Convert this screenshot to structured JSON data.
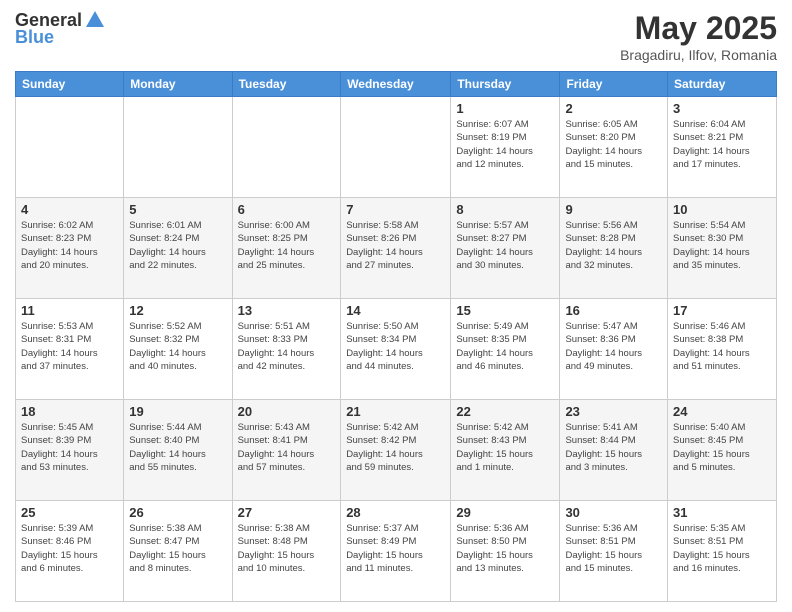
{
  "header": {
    "logo_general": "General",
    "logo_blue": "Blue",
    "title": "May 2025",
    "location": "Bragadiru, Ilfov, Romania"
  },
  "weekdays": [
    "Sunday",
    "Monday",
    "Tuesday",
    "Wednesday",
    "Thursday",
    "Friday",
    "Saturday"
  ],
  "weeks": [
    [
      {
        "day": "",
        "info": ""
      },
      {
        "day": "",
        "info": ""
      },
      {
        "day": "",
        "info": ""
      },
      {
        "day": "",
        "info": ""
      },
      {
        "day": "1",
        "info": "Sunrise: 6:07 AM\nSunset: 8:19 PM\nDaylight: 14 hours\nand 12 minutes."
      },
      {
        "day": "2",
        "info": "Sunrise: 6:05 AM\nSunset: 8:20 PM\nDaylight: 14 hours\nand 15 minutes."
      },
      {
        "day": "3",
        "info": "Sunrise: 6:04 AM\nSunset: 8:21 PM\nDaylight: 14 hours\nand 17 minutes."
      }
    ],
    [
      {
        "day": "4",
        "info": "Sunrise: 6:02 AM\nSunset: 8:23 PM\nDaylight: 14 hours\nand 20 minutes."
      },
      {
        "day": "5",
        "info": "Sunrise: 6:01 AM\nSunset: 8:24 PM\nDaylight: 14 hours\nand 22 minutes."
      },
      {
        "day": "6",
        "info": "Sunrise: 6:00 AM\nSunset: 8:25 PM\nDaylight: 14 hours\nand 25 minutes."
      },
      {
        "day": "7",
        "info": "Sunrise: 5:58 AM\nSunset: 8:26 PM\nDaylight: 14 hours\nand 27 minutes."
      },
      {
        "day": "8",
        "info": "Sunrise: 5:57 AM\nSunset: 8:27 PM\nDaylight: 14 hours\nand 30 minutes."
      },
      {
        "day": "9",
        "info": "Sunrise: 5:56 AM\nSunset: 8:28 PM\nDaylight: 14 hours\nand 32 minutes."
      },
      {
        "day": "10",
        "info": "Sunrise: 5:54 AM\nSunset: 8:30 PM\nDaylight: 14 hours\nand 35 minutes."
      }
    ],
    [
      {
        "day": "11",
        "info": "Sunrise: 5:53 AM\nSunset: 8:31 PM\nDaylight: 14 hours\nand 37 minutes."
      },
      {
        "day": "12",
        "info": "Sunrise: 5:52 AM\nSunset: 8:32 PM\nDaylight: 14 hours\nand 40 minutes."
      },
      {
        "day": "13",
        "info": "Sunrise: 5:51 AM\nSunset: 8:33 PM\nDaylight: 14 hours\nand 42 minutes."
      },
      {
        "day": "14",
        "info": "Sunrise: 5:50 AM\nSunset: 8:34 PM\nDaylight: 14 hours\nand 44 minutes."
      },
      {
        "day": "15",
        "info": "Sunrise: 5:49 AM\nSunset: 8:35 PM\nDaylight: 14 hours\nand 46 minutes."
      },
      {
        "day": "16",
        "info": "Sunrise: 5:47 AM\nSunset: 8:36 PM\nDaylight: 14 hours\nand 49 minutes."
      },
      {
        "day": "17",
        "info": "Sunrise: 5:46 AM\nSunset: 8:38 PM\nDaylight: 14 hours\nand 51 minutes."
      }
    ],
    [
      {
        "day": "18",
        "info": "Sunrise: 5:45 AM\nSunset: 8:39 PM\nDaylight: 14 hours\nand 53 minutes."
      },
      {
        "day": "19",
        "info": "Sunrise: 5:44 AM\nSunset: 8:40 PM\nDaylight: 14 hours\nand 55 minutes."
      },
      {
        "day": "20",
        "info": "Sunrise: 5:43 AM\nSunset: 8:41 PM\nDaylight: 14 hours\nand 57 minutes."
      },
      {
        "day": "21",
        "info": "Sunrise: 5:42 AM\nSunset: 8:42 PM\nDaylight: 14 hours\nand 59 minutes."
      },
      {
        "day": "22",
        "info": "Sunrise: 5:42 AM\nSunset: 8:43 PM\nDaylight: 15 hours\nand 1 minute."
      },
      {
        "day": "23",
        "info": "Sunrise: 5:41 AM\nSunset: 8:44 PM\nDaylight: 15 hours\nand 3 minutes."
      },
      {
        "day": "24",
        "info": "Sunrise: 5:40 AM\nSunset: 8:45 PM\nDaylight: 15 hours\nand 5 minutes."
      }
    ],
    [
      {
        "day": "25",
        "info": "Sunrise: 5:39 AM\nSunset: 8:46 PM\nDaylight: 15 hours\nand 6 minutes."
      },
      {
        "day": "26",
        "info": "Sunrise: 5:38 AM\nSunset: 8:47 PM\nDaylight: 15 hours\nand 8 minutes."
      },
      {
        "day": "27",
        "info": "Sunrise: 5:38 AM\nSunset: 8:48 PM\nDaylight: 15 hours\nand 10 minutes."
      },
      {
        "day": "28",
        "info": "Sunrise: 5:37 AM\nSunset: 8:49 PM\nDaylight: 15 hours\nand 11 minutes."
      },
      {
        "day": "29",
        "info": "Sunrise: 5:36 AM\nSunset: 8:50 PM\nDaylight: 15 hours\nand 13 minutes."
      },
      {
        "day": "30",
        "info": "Sunrise: 5:36 AM\nSunset: 8:51 PM\nDaylight: 15 hours\nand 15 minutes."
      },
      {
        "day": "31",
        "info": "Sunrise: 5:35 AM\nSunset: 8:51 PM\nDaylight: 15 hours\nand 16 minutes."
      }
    ]
  ]
}
